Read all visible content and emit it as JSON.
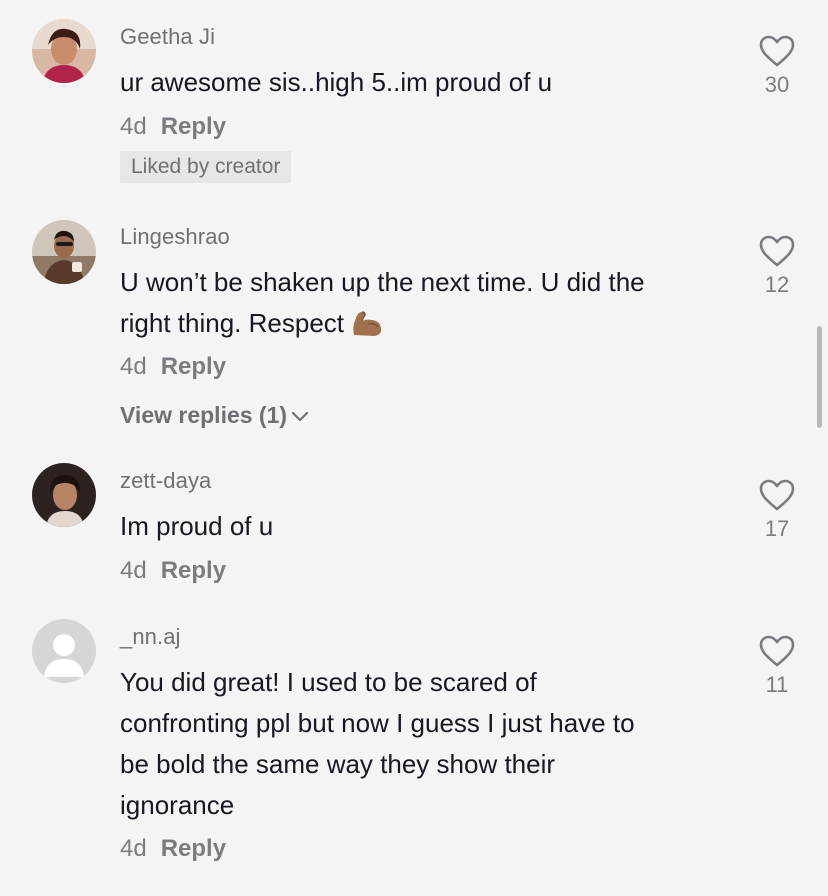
{
  "comments": [
    {
      "username": "Geetha Ji",
      "text": "ur awesome sis..high 5..im proud of u",
      "time": "4d",
      "reply_label": "Reply",
      "badge": "Liked by creator",
      "likes": "30",
      "avatar_icon": "user-photo-icon"
    },
    {
      "username": "Lingeshrao",
      "text_line1": "U won’t be shaken up the next time. U did the",
      "text_line2": "right thing. Respect",
      "emoji_icon": "flexed-biceps-icon",
      "time": "4d",
      "reply_label": "Reply",
      "view_replies": "View replies (1)",
      "likes": "12",
      "avatar_icon": "user-photo-icon"
    },
    {
      "username": "zett-daya",
      "text": "Im proud of u",
      "time": "4d",
      "reply_label": "Reply",
      "likes": "17",
      "avatar_icon": "user-photo-icon"
    },
    {
      "username": "_nn.aj",
      "text_lines": [
        "You did great! I used to be scared of",
        "confronting ppl but now I guess I just have to",
        "be bold the same way they show their",
        "ignorance"
      ],
      "time": "4d",
      "reply_label": "Reply",
      "likes": "11",
      "avatar_icon": "default-avatar-icon"
    }
  ],
  "colors": {
    "background": "#f4f4f4",
    "text": "#161823",
    "secondary": "#6f7076",
    "badge_bg": "#e6e6e6"
  }
}
